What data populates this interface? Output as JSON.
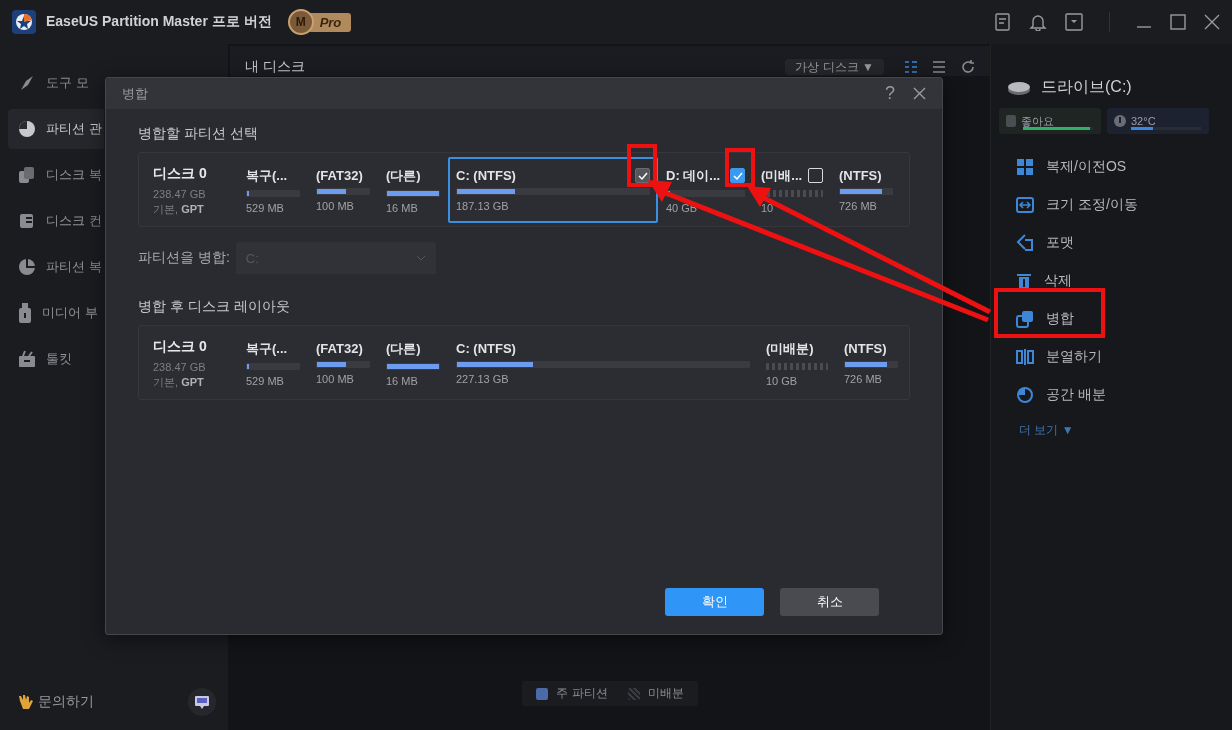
{
  "titlebar": {
    "app_name": "EaseUS Partition Master 프로 버전",
    "badge": {
      "letter": "M",
      "label": "Pro"
    }
  },
  "sidebar": {
    "items": [
      {
        "label": "도구 모",
        "kind": "tools",
        "selected": false
      },
      {
        "label": "파티션 관",
        "kind": "partition",
        "selected": true
      },
      {
        "label": "디스크 복",
        "kind": "clone",
        "selected": false
      },
      {
        "label": "디스크 컨",
        "kind": "convert",
        "selected": false
      },
      {
        "label": "파티션 복",
        "kind": "recover",
        "selected": false
      },
      {
        "label": "미디어 부",
        "kind": "media",
        "selected": false
      },
      {
        "label": "툴킷",
        "kind": "toolkit",
        "selected": false
      }
    ],
    "support": "문의하기"
  },
  "main": {
    "title": "내 디스크",
    "view_dropdown": "가상 디스크 ▼",
    "legend": [
      {
        "label": "주 파티션",
        "kind": "primary"
      },
      {
        "label": "미배분",
        "kind": "unallocated"
      }
    ]
  },
  "right_panel": {
    "drive": "드라이브(C:)",
    "health": {
      "label": "좋아요",
      "level": 0.95
    },
    "temperature": {
      "label": "32°C",
      "level": 0.32
    },
    "actions": [
      {
        "label": "복제/이전OS",
        "kind": "clone"
      },
      {
        "label": "크기 조정/이동",
        "kind": "resize"
      },
      {
        "label": "포맷",
        "kind": "format"
      },
      {
        "label": "삭제",
        "kind": "delete"
      },
      {
        "label": "병합",
        "kind": "merge"
      },
      {
        "label": "분열하기",
        "kind": "split"
      },
      {
        "label": "공간 배분",
        "kind": "allocate"
      }
    ],
    "more": "더 보기 ▼"
  },
  "dialog": {
    "title": "병합",
    "help": "?",
    "section_select": "병합할 파티션 선택",
    "source_disk": {
      "name": "디스크 0",
      "size": "238.47 GB",
      "type": "기본, **GPT**",
      "partitions": [
        {
          "name": "복구(...",
          "kind": "partition",
          "level": 0.04,
          "size": "529 MB",
          "selected": false
        },
        {
          "name": "(FAT32)",
          "kind": "partition",
          "level": 0.55,
          "size": "100 MB",
          "selected": false
        },
        {
          "name": "(다른)",
          "kind": "partition",
          "level": 1,
          "size": "16 MB",
          "selected": false
        },
        {
          "name": "C: (NTFS)",
          "kind": "partition",
          "level": 0.3,
          "size": "187.13 GB",
          "selected": true,
          "checkbox": {
            "checked": true,
            "disabled": true
          }
        },
        {
          "name": "D: 데이...",
          "kind": "partition",
          "level": 0.04,
          "size": "40 GB",
          "selected": false,
          "checkbox": {
            "checked": true,
            "disabled": false
          }
        },
        {
          "name": "(미배...",
          "kind": "unallocated",
          "size": "10",
          "selected": false,
          "checkbox": {
            "checked": false,
            "disabled": false
          }
        },
        {
          "name": "(NTFS)",
          "kind": "partition",
          "level": 0.8,
          "size": "726 MB",
          "selected": false
        }
      ]
    },
    "merge_into": {
      "label": "파티션을 병합:",
      "value": "C:",
      "disabled": true
    },
    "section_result": "병합 후 디스크 레이아웃",
    "result_disk": {
      "name": "디스크 0",
      "size": "238.47 GB",
      "type": "기본, **GPT**",
      "partitions": [
        {
          "name": "복구(...",
          "kind": "partition",
          "level": 0.04,
          "size": "529 MB"
        },
        {
          "name": "(FAT32)",
          "kind": "partition",
          "level": 0.55,
          "size": "100 MB"
        },
        {
          "name": "(다른)",
          "kind": "partition",
          "level": 1,
          "size": "16 MB"
        },
        {
          "name": "C: (NTFS)",
          "kind": "partition",
          "level": 0.26,
          "size": "227.13 GB"
        },
        {
          "name": "(미배분)",
          "kind": "unallocated",
          "size": "10 GB"
        },
        {
          "name": "(NTFS)",
          "kind": "partition",
          "level": 0.8,
          "size": "726 MB"
        }
      ]
    },
    "buttons": [
      {
        "label": "확인",
        "kind": "primary"
      },
      {
        "label": "취소",
        "kind": "secondary"
      }
    ]
  }
}
